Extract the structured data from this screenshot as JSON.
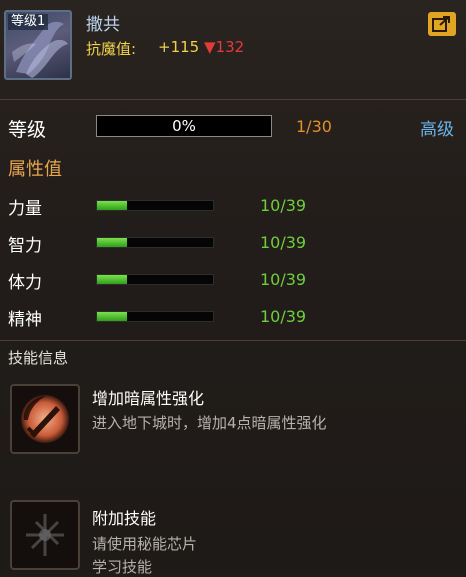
{
  "item": {
    "level_badge": "等级1",
    "name": "撒共",
    "resist_label": "抗魔值:",
    "resist_value": "+115",
    "resist_change": "▼132",
    "share_icon": "share-icon"
  },
  "level": {
    "label": "等级",
    "progress_text": "0%",
    "progress": 0,
    "count": "1/30",
    "advanced_label": "高级"
  },
  "attributes": {
    "title": "属性值",
    "items": [
      {
        "label": "力量",
        "value": "10/39",
        "fill": 0.256
      },
      {
        "label": "智力",
        "value": "10/39",
        "fill": 0.256
      },
      {
        "label": "体力",
        "value": "10/39",
        "fill": 0.256
      },
      {
        "label": "精神",
        "value": "10/39",
        "fill": 0.256
      }
    ]
  },
  "skills": {
    "title": "技能信息",
    "items": [
      {
        "name": "增加暗属性强化",
        "desc": "进入地下城时，增加4点暗属性强化",
        "icon": "dark-sword-icon"
      },
      {
        "name": "附加技能",
        "desc": "请使用秘能芯片",
        "desc2": "学习技能",
        "icon": "locked-skill-icon"
      }
    ]
  },
  "colors": {
    "accent_gold": "#f0d24a",
    "level_orange": "#e38f2a",
    "stat_green": "#6fce3c",
    "link_blue": "#6ab3e8",
    "down_red": "#e33a3a"
  }
}
